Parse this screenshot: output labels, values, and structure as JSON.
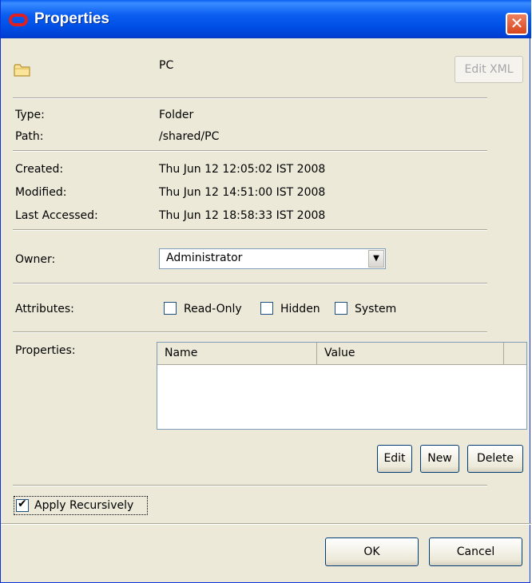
{
  "window": {
    "title": "Properties"
  },
  "header": {
    "name": "PC",
    "edit_xml_label": "Edit XML"
  },
  "info": {
    "type_label": "Type:",
    "type_value": "Folder",
    "path_label": "Path:",
    "path_value": "/shared/PC",
    "created_label": "Created:",
    "created_value": "Thu Jun 12 12:05:02 IST 2008",
    "modified_label": "Modified:",
    "modified_value": "Thu Jun 12 14:51:00 IST 2008",
    "accessed_label": "Last Accessed:",
    "accessed_value": "Thu Jun 12 18:58:33 IST 2008"
  },
  "owner": {
    "label": "Owner:",
    "selected": "Administrator"
  },
  "attributes": {
    "label": "Attributes:",
    "read_only": "Read-Only",
    "hidden": "Hidden",
    "system": "System"
  },
  "properties": {
    "label": "Properties:",
    "columns": [
      "Name",
      "Value"
    ],
    "edit_label": "Edit",
    "new_label": "New",
    "delete_label": "Delete"
  },
  "apply_recursively": {
    "label": "Apply Recursively",
    "checked": true
  },
  "footer": {
    "ok_label": "OK",
    "cancel_label": "Cancel"
  }
}
